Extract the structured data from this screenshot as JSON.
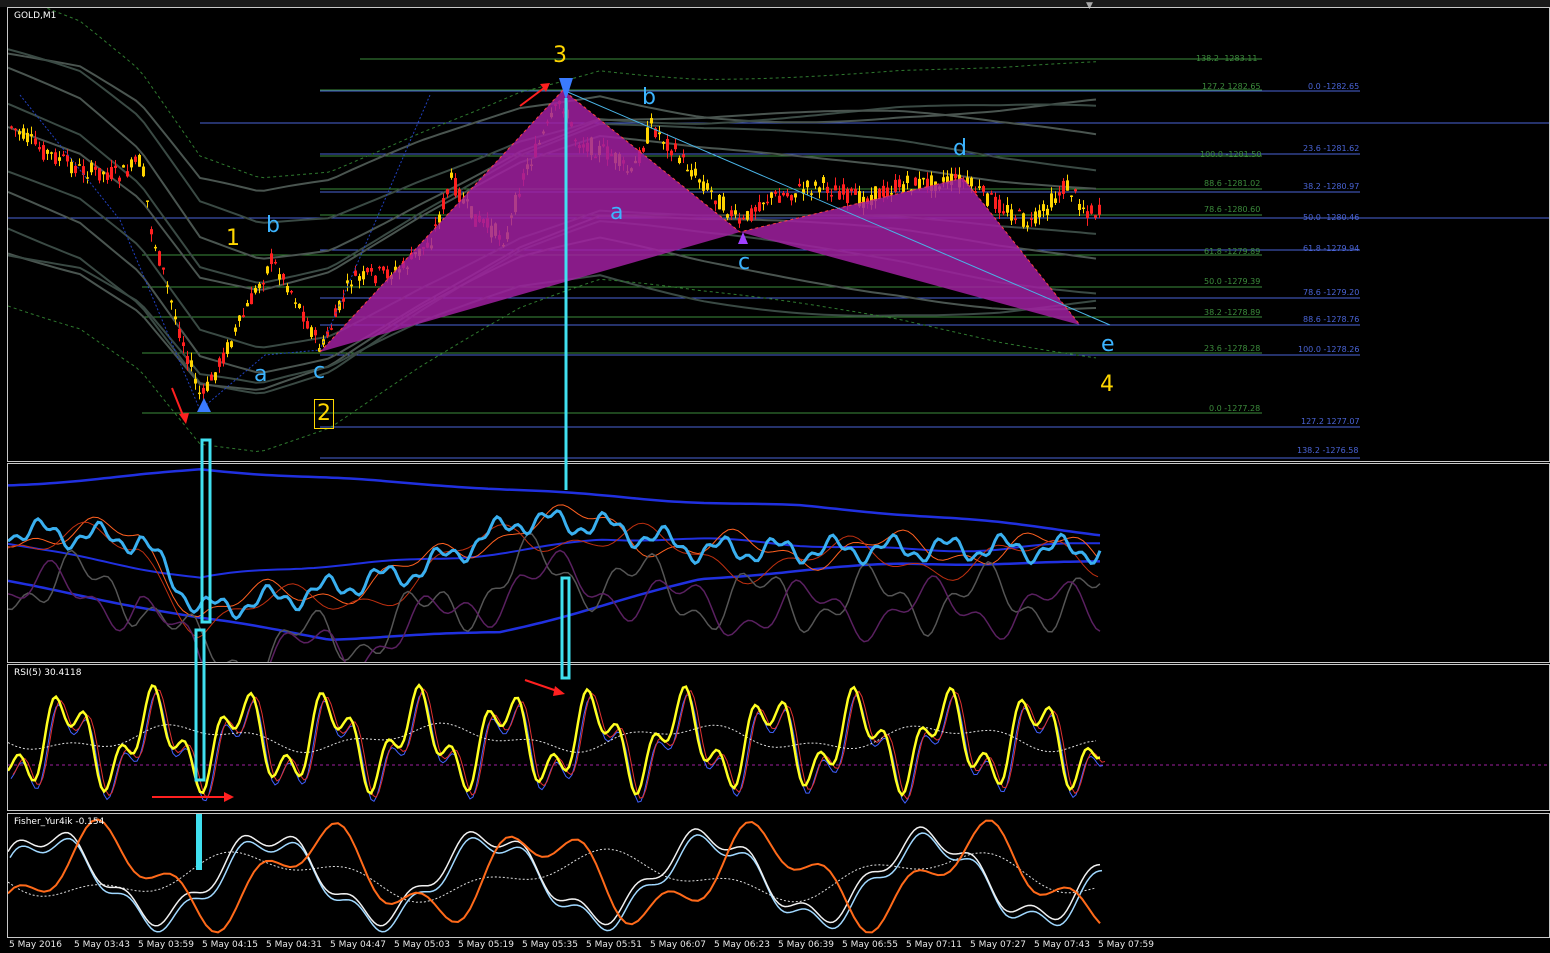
{
  "toolbar": {
    "scroll_arrow": "▼"
  },
  "panes": {
    "main": {
      "title": "GOLD,M1"
    },
    "rsi": {
      "title": "RSI(5) 30.4118"
    },
    "fisher": {
      "title": "Fisher_Yur4ik -0.154"
    }
  },
  "fib_left": [
    {
      "text": "138.2 -1283.11"
    },
    {
      "text": "127.2 1282.65"
    },
    {
      "text": "100.0 -1281.50"
    },
    {
      "text": "88.6 -1281.02"
    },
    {
      "text": "78.6 -1280.60"
    },
    {
      "text": "61.8 -1279.89"
    },
    {
      "text": "50.0 -1279.39"
    },
    {
      "text": "38.2 -1278.89"
    },
    {
      "text": "23.6 -1278.28"
    },
    {
      "text": "0.0 -1277.28"
    }
  ],
  "fib_right": [
    {
      "text": "0.0 -1282.65"
    },
    {
      "text": "23.6 -1281.62"
    },
    {
      "text": "38.2 -1280.97"
    },
    {
      "text": "50.0 -1280.46"
    },
    {
      "text": "61.8 -1279.94"
    },
    {
      "text": "78.6 -1279.20"
    },
    {
      "text": "88.6 -1278.76"
    },
    {
      "text": "100.0 -1278.26"
    },
    {
      "text": "127.2 1277.07"
    },
    {
      "text": "138.2 -1276.58"
    }
  ],
  "waves": {
    "w1": "1",
    "w2": "2",
    "w3": "3",
    "w4": "4",
    "b1": "b",
    "a1": "a",
    "c1": "c",
    "b2": "b",
    "a2": "a",
    "c2": "c",
    "d2": "d",
    "e2": "e"
  },
  "time_axis": [
    "5 May 2016",
    "5 May 03:43",
    "5 May 03:59",
    "5 May 04:15",
    "5 May 04:31",
    "5 May 04:47",
    "5 May 05:03",
    "5 May 05:19",
    "5 May 05:35",
    "5 May 05:51",
    "5 May 06:07",
    "5 May 06:23",
    "5 May 06:39",
    "5 May 06:55",
    "5 May 07:11",
    "5 May 07:27",
    "5 May 07:43",
    "5 May 07:59"
  ],
  "colors": {
    "bull": "#ffd400",
    "bear": "#ff2020",
    "rsi": "#ffff20",
    "fib_green": "#3c8c3c",
    "fib_blue": "#4a64d6",
    "pattern": "#a020a0",
    "cyan": "#40e0f0",
    "wave_yellow": "#ffd700",
    "wave_cyan": "#3cb4ff"
  }
}
